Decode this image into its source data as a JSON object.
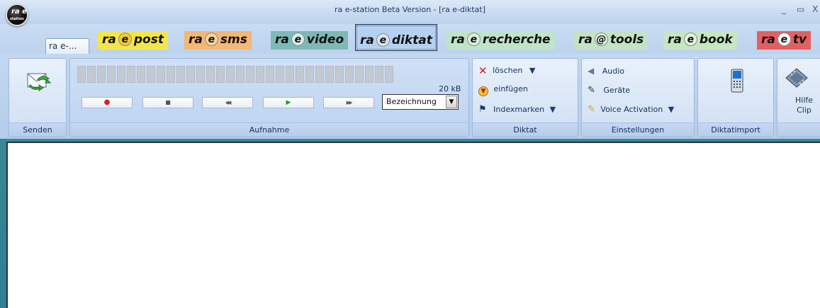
{
  "window": {
    "title": "ra e-station Beta Version - [ra e-diktat]",
    "logo_text_top": "ra e",
    "logo_text_bottom": "station",
    "minimize_glyph": "_",
    "restore_glyph": "▭",
    "close_glyph": "X"
  },
  "tabs": {
    "home_label": "ra e-...",
    "modules": [
      {
        "pre": "ra",
        "e": "e",
        "post": "post",
        "color": "#f4e64a",
        "e_color": "#f6c63a"
      },
      {
        "pre": "ra",
        "e": "e",
        "post": "sms",
        "color": "#f4b774",
        "e_color": "#f2d49a"
      },
      {
        "pre": "ra",
        "e": "e",
        "post": "video",
        "color": "#7fb9b4",
        "e_color": "#d7ebe8"
      },
      {
        "pre": "ra",
        "e": "e",
        "post": "diktat",
        "color": "#b5d1f1",
        "e_color": "#d6e4f5"
      },
      {
        "pre": "ra",
        "e": "e",
        "post": "recherche",
        "color": "#bfe4c8",
        "e_color": "#d9efde"
      },
      {
        "pre": "ra",
        "e": "@",
        "post": "tools",
        "color": "#c2e3c4",
        "e_color": "#dcefdd"
      },
      {
        "pre": "ra",
        "e": "e",
        "post": "book",
        "color": "#c6e6c2",
        "e_color": "#e2f1e0"
      },
      {
        "pre": "ra",
        "e": "e",
        "post": "tv",
        "color": "#e36060",
        "e_color": "#ffffff"
      }
    ],
    "active": "diktat"
  },
  "ribbon": {
    "senden": {
      "label": "Senden",
      "icon": "send-mail-icon"
    },
    "aufnahme": {
      "label": "Aufnahme",
      "size": "20 kB",
      "buttons": [
        {
          "name": "record-button",
          "glyph": "●",
          "color": "#e11b1b"
        },
        {
          "name": "stop-button",
          "glyph": "■",
          "color": "#444444"
        },
        {
          "name": "rewind-button",
          "glyph": "◀◀",
          "color": "#444444"
        },
        {
          "name": "play-button",
          "glyph": "▶",
          "color": "#1aa01a"
        },
        {
          "name": "forward-button",
          "glyph": "▶▶",
          "color": "#444444"
        }
      ],
      "select_value": "Bezeichnung"
    },
    "diktat": {
      "label": "Diktat",
      "items": [
        "löschen",
        "einfügen",
        "Indexmarken"
      ]
    },
    "einstellungen": {
      "label": "Einstellungen",
      "items": [
        "Audio",
        "Geräte",
        "Voice Activation"
      ]
    },
    "diktatimport": {
      "label": "Diktatimport"
    },
    "hilfe": {
      "line1": "Hilfe",
      "line2": "Clip"
    }
  }
}
